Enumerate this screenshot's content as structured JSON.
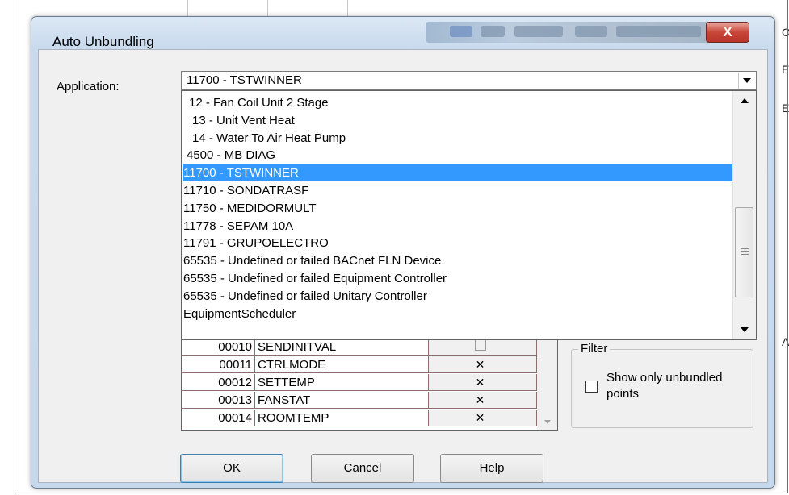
{
  "background": {
    "edge_letters": [
      "O",
      "E",
      "E",
      "AL"
    ]
  },
  "dialog": {
    "title": "Auto Unbundling",
    "close_symbol": "X"
  },
  "application": {
    "label": "Application:",
    "selected_value": "11700 - TSTWINNER",
    "options": [
      "12 - Fan Coil Unit 2 Stage",
      "13 - Unit Vent Heat",
      "14 - Water To Air Heat Pump",
      "4500 - MB DIAG",
      "11700 - TSTWINNER",
      "11710 - SONDATRASF",
      "11750 - MEDIDORMULT",
      "11778 - SEPAM 10A",
      "11791 - GRUPOELECTRO",
      "65535 - Undefined or failed BACnet FLN Device",
      "65535 - Undefined or failed Equipment Controller",
      "65535 - Undefined or failed Unitary Controller",
      "EquipmentScheduler"
    ],
    "selected_index": 4
  },
  "points": {
    "rows": [
      {
        "num": "00010",
        "name": "SENDINITVAL",
        "checked": false
      },
      {
        "num": "00011",
        "name": "CTRLMODE",
        "checked": true
      },
      {
        "num": "00012",
        "name": "SETTEMP",
        "checked": true
      },
      {
        "num": "00013",
        "name": "FANSTAT",
        "checked": true
      },
      {
        "num": "00014",
        "name": "ROOMTEMP",
        "checked": true
      }
    ],
    "check_symbol": "✕"
  },
  "filter": {
    "legend": "Filter",
    "option_label": "Show only unbundled points",
    "checked": false
  },
  "buttons": {
    "ok": "OK",
    "cancel": "Cancel",
    "help": "Help"
  },
  "colors": {
    "selection": "#3399ff",
    "close_button": "#c9463a"
  }
}
